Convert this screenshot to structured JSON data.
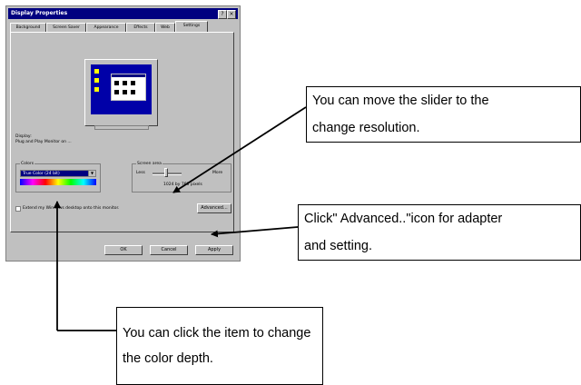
{
  "dialog": {
    "title": "Display Properties",
    "title_buttons": {
      "help": "?",
      "close": "×"
    },
    "tabs": [
      "Background",
      "Screen Saver",
      "Appearance",
      "Effects",
      "Web",
      "Settings"
    ],
    "monitor_label": "Display:",
    "monitor_value": "Plug and Play Monitor on ...",
    "colors_label": "Colors",
    "colors_selected": "True Color (24 bit)",
    "screen_area_label": "Screen area",
    "screen_area_less": "Less",
    "screen_area_more": "More",
    "screen_area_value": "1024 by 768 pixels",
    "extend_checkbox": "Extend my Windows desktop onto this monitor.",
    "advanced_button": "Advanced...",
    "ok_button": "OK",
    "cancel_button": "Cancel",
    "apply_button": "Apply"
  },
  "callouts": {
    "slider": [
      "You can move the slider to the",
      "change resolution."
    ],
    "advanced": [
      "Click\" Advanced..\"icon for adapter",
      "and setting."
    ],
    "color": [
      "You can click the item to change",
      "the color depth."
    ]
  },
  "colors": {
    "title_bar": "#000080",
    "dialog_face": "#c0c0c0",
    "desktop": "#0000a8"
  }
}
